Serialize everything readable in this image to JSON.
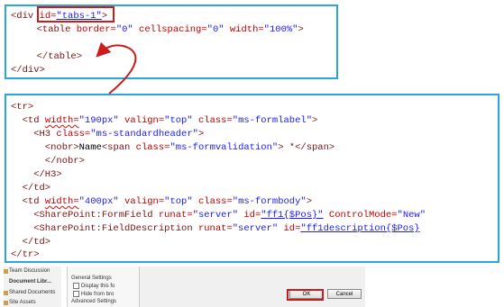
{
  "top_code": {
    "l1_open": "<div ",
    "l1_attr": "id=",
    "l1_val": "\"tabs-1\"",
    "l1_close": ">",
    "l2_open": "  <table ",
    "l2_a1": "border=",
    "l2_v1": "\"0\"",
    "l2_a2": " cellspacing=",
    "l2_v2": "\"0\"",
    "l2_a3": " width=",
    "l2_v3": "\"100%\"",
    "l2_close": ">",
    "l4": "  </table>",
    "l5": "</div>"
  },
  "bottom_code": {
    "tr_open": "<tr>",
    "td1_open": "  <td ",
    "td1_a1": "width=",
    "td1_v1": "\"190px\"",
    "td1_a2": " valign=",
    "td1_v2": "\"top\"",
    "td1_a3": " class=",
    "td1_v3": "\"ms-formlabel\"",
    "td1_close": ">",
    "h3_open": "    <H3 ",
    "h3_a": "class=",
    "h3_v": "\"ms-standardheader\"",
    "h3_close": ">",
    "nobr_open": "      <nobr>",
    "nobr_text": "Name",
    "span_open": "<span ",
    "span_a": "class=",
    "span_v": "\"ms-formvalidation\"",
    "span_text": "> *</span>",
    "nobr_close": "      </nobr>",
    "h3_end": "    </H3>",
    "td_end1": "  </td>",
    "td2_open": "  <td ",
    "td2_a1": "width=",
    "td2_v1": "\"400px\"",
    "td2_a2": " valign=",
    "td2_v2": "\"top\"",
    "td2_a3": " class=",
    "td2_v3": "\"ms-formbody\"",
    "td2_close": ">",
    "ff_open": "    <SharePoint:FormField ",
    "ff_a1": "runat=",
    "ff_v1": "\"server\"",
    "ff_a2": " id=",
    "ff_v2": "\"ff1{$Pos}\"",
    "ff_a3": " ControlMode=",
    "ff_v3": "\"New\"",
    "fd_open": "    <SharePoint:FieldDescription ",
    "fd_a1": "runat=",
    "fd_v1": "\"server\"",
    "fd_a2": " id=",
    "fd_v2": "\"ff1description{$Pos}",
    "td_end2": "  </td>",
    "tr_close": "</tr>"
  },
  "dialog": {
    "side_items": [
      "Team Discussion",
      "Document Libr...",
      "Shared Documents",
      "Site Assets"
    ],
    "general_settings": "General Settings",
    "display_option": "Display this fo",
    "hide_option": "Hide from bro",
    "advanced_settings": "Advanced Settings",
    "ok_label": "OK",
    "cancel_label": "Cancel"
  },
  "colors": {
    "panel_border": "#2aa7d6",
    "highlight": "#cc1b1b",
    "tag": "#7a1212",
    "attr": "#c00000",
    "value": "#1a1aff"
  }
}
